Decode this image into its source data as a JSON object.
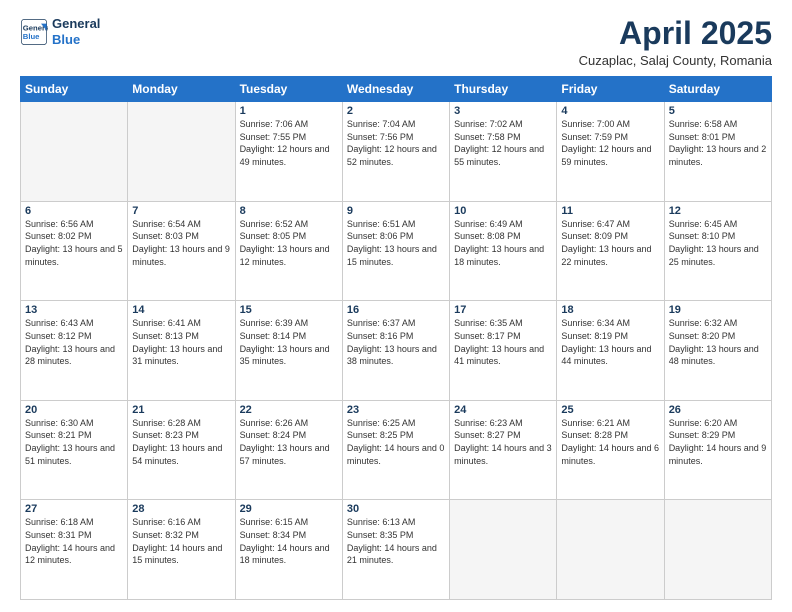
{
  "header": {
    "logo_line1": "General",
    "logo_line2": "Blue",
    "month_title": "April 2025",
    "location": "Cuzaplac, Salaj County, Romania"
  },
  "days_of_week": [
    "Sunday",
    "Monday",
    "Tuesday",
    "Wednesday",
    "Thursday",
    "Friday",
    "Saturday"
  ],
  "weeks": [
    [
      {
        "day": "",
        "info": ""
      },
      {
        "day": "",
        "info": ""
      },
      {
        "day": "1",
        "info": "Sunrise: 7:06 AM\nSunset: 7:55 PM\nDaylight: 12 hours and 49 minutes."
      },
      {
        "day": "2",
        "info": "Sunrise: 7:04 AM\nSunset: 7:56 PM\nDaylight: 12 hours and 52 minutes."
      },
      {
        "day": "3",
        "info": "Sunrise: 7:02 AM\nSunset: 7:58 PM\nDaylight: 12 hours and 55 minutes."
      },
      {
        "day": "4",
        "info": "Sunrise: 7:00 AM\nSunset: 7:59 PM\nDaylight: 12 hours and 59 minutes."
      },
      {
        "day": "5",
        "info": "Sunrise: 6:58 AM\nSunset: 8:01 PM\nDaylight: 13 hours and 2 minutes."
      }
    ],
    [
      {
        "day": "6",
        "info": "Sunrise: 6:56 AM\nSunset: 8:02 PM\nDaylight: 13 hours and 5 minutes."
      },
      {
        "day": "7",
        "info": "Sunrise: 6:54 AM\nSunset: 8:03 PM\nDaylight: 13 hours and 9 minutes."
      },
      {
        "day": "8",
        "info": "Sunrise: 6:52 AM\nSunset: 8:05 PM\nDaylight: 13 hours and 12 minutes."
      },
      {
        "day": "9",
        "info": "Sunrise: 6:51 AM\nSunset: 8:06 PM\nDaylight: 13 hours and 15 minutes."
      },
      {
        "day": "10",
        "info": "Sunrise: 6:49 AM\nSunset: 8:08 PM\nDaylight: 13 hours and 18 minutes."
      },
      {
        "day": "11",
        "info": "Sunrise: 6:47 AM\nSunset: 8:09 PM\nDaylight: 13 hours and 22 minutes."
      },
      {
        "day": "12",
        "info": "Sunrise: 6:45 AM\nSunset: 8:10 PM\nDaylight: 13 hours and 25 minutes."
      }
    ],
    [
      {
        "day": "13",
        "info": "Sunrise: 6:43 AM\nSunset: 8:12 PM\nDaylight: 13 hours and 28 minutes."
      },
      {
        "day": "14",
        "info": "Sunrise: 6:41 AM\nSunset: 8:13 PM\nDaylight: 13 hours and 31 minutes."
      },
      {
        "day": "15",
        "info": "Sunrise: 6:39 AM\nSunset: 8:14 PM\nDaylight: 13 hours and 35 minutes."
      },
      {
        "day": "16",
        "info": "Sunrise: 6:37 AM\nSunset: 8:16 PM\nDaylight: 13 hours and 38 minutes."
      },
      {
        "day": "17",
        "info": "Sunrise: 6:35 AM\nSunset: 8:17 PM\nDaylight: 13 hours and 41 minutes."
      },
      {
        "day": "18",
        "info": "Sunrise: 6:34 AM\nSunset: 8:19 PM\nDaylight: 13 hours and 44 minutes."
      },
      {
        "day": "19",
        "info": "Sunrise: 6:32 AM\nSunset: 8:20 PM\nDaylight: 13 hours and 48 minutes."
      }
    ],
    [
      {
        "day": "20",
        "info": "Sunrise: 6:30 AM\nSunset: 8:21 PM\nDaylight: 13 hours and 51 minutes."
      },
      {
        "day": "21",
        "info": "Sunrise: 6:28 AM\nSunset: 8:23 PM\nDaylight: 13 hours and 54 minutes."
      },
      {
        "day": "22",
        "info": "Sunrise: 6:26 AM\nSunset: 8:24 PM\nDaylight: 13 hours and 57 minutes."
      },
      {
        "day": "23",
        "info": "Sunrise: 6:25 AM\nSunset: 8:25 PM\nDaylight: 14 hours and 0 minutes."
      },
      {
        "day": "24",
        "info": "Sunrise: 6:23 AM\nSunset: 8:27 PM\nDaylight: 14 hours and 3 minutes."
      },
      {
        "day": "25",
        "info": "Sunrise: 6:21 AM\nSunset: 8:28 PM\nDaylight: 14 hours and 6 minutes."
      },
      {
        "day": "26",
        "info": "Sunrise: 6:20 AM\nSunset: 8:29 PM\nDaylight: 14 hours and 9 minutes."
      }
    ],
    [
      {
        "day": "27",
        "info": "Sunrise: 6:18 AM\nSunset: 8:31 PM\nDaylight: 14 hours and 12 minutes."
      },
      {
        "day": "28",
        "info": "Sunrise: 6:16 AM\nSunset: 8:32 PM\nDaylight: 14 hours and 15 minutes."
      },
      {
        "day": "29",
        "info": "Sunrise: 6:15 AM\nSunset: 8:34 PM\nDaylight: 14 hours and 18 minutes."
      },
      {
        "day": "30",
        "info": "Sunrise: 6:13 AM\nSunset: 8:35 PM\nDaylight: 14 hours and 21 minutes."
      },
      {
        "day": "",
        "info": ""
      },
      {
        "day": "",
        "info": ""
      },
      {
        "day": "",
        "info": ""
      }
    ]
  ]
}
